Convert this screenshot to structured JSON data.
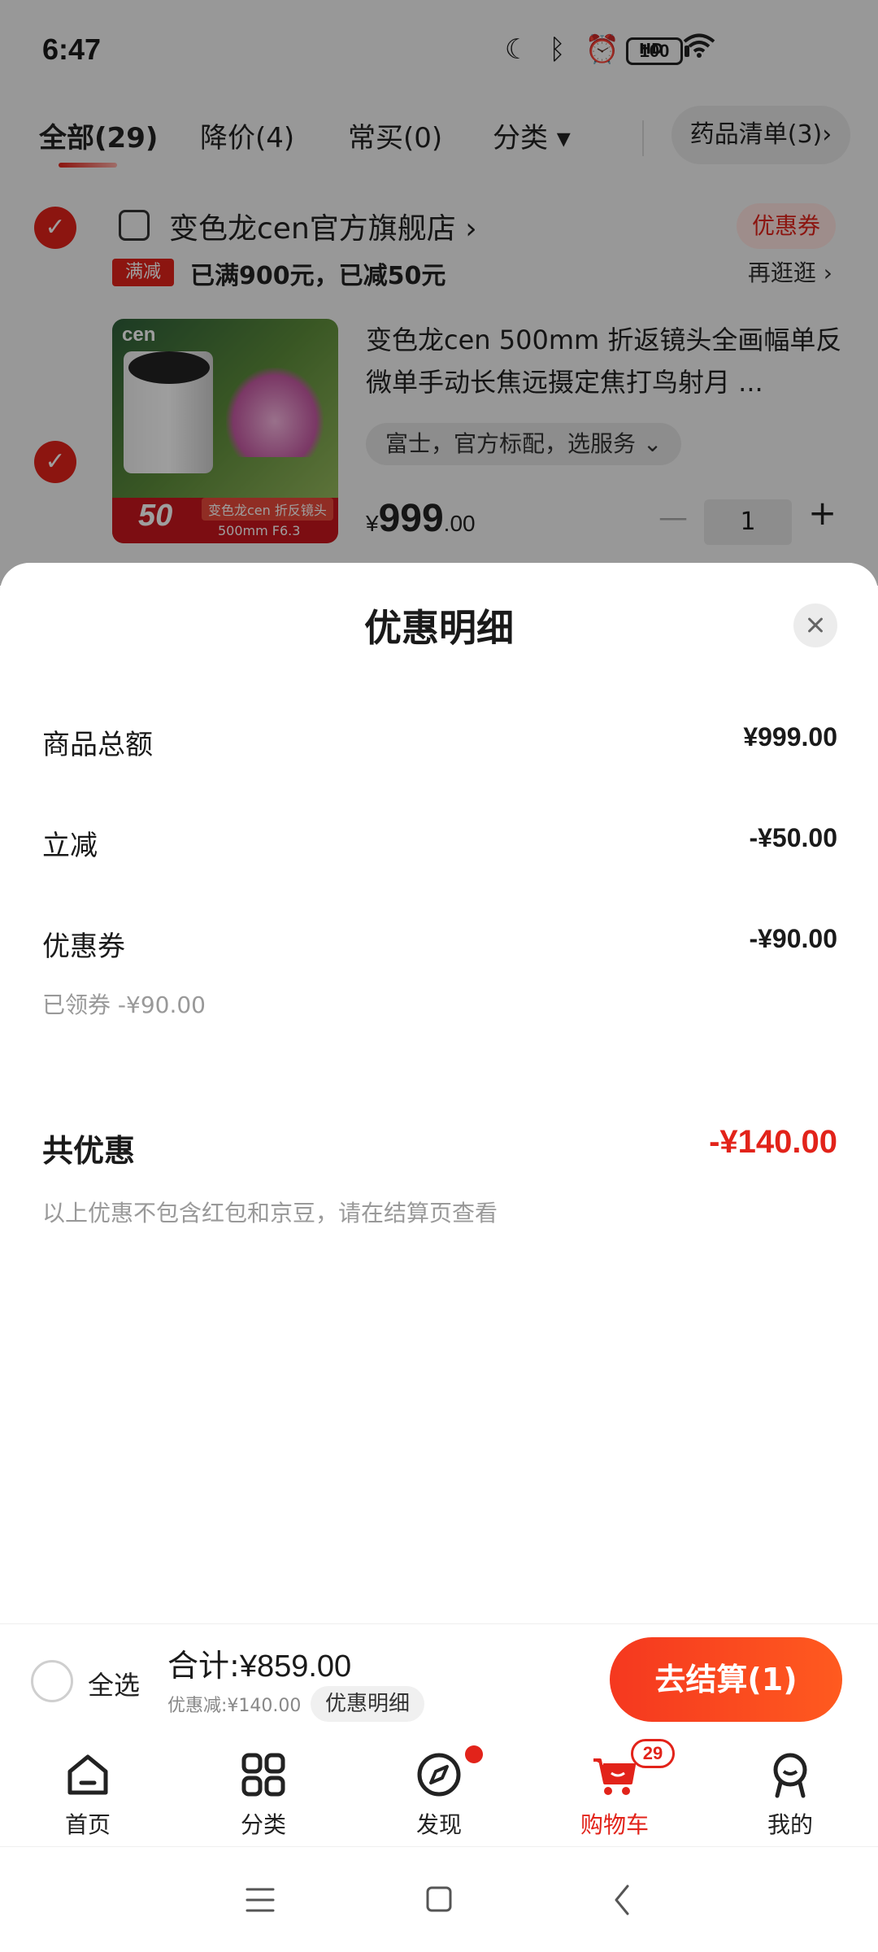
{
  "status_bar": {
    "time": "6:47",
    "battery": "100",
    "signal_label": "HD"
  },
  "tabs": [
    {
      "label": "全部(29)",
      "active": true
    },
    {
      "label": "降价(4)",
      "active": false
    },
    {
      "label": "常买(0)",
      "active": false
    },
    {
      "label": "分类 ▾",
      "active": false
    }
  ],
  "drug_list": "药品清单(3)›",
  "store": {
    "name": "变色龙cen官方旗舰店 ›",
    "coupon_tag": "优惠券",
    "promo_badge": "满减",
    "promo_text": "已满900元，已减50元",
    "promo_more": "再逛逛 ›"
  },
  "product": {
    "title": "变色龙cen 500mm 折返镜头全画幅单反微单手动长焦远摄定焦打鸟射月 ...",
    "spec": "富士，官方标配，选服务 ⌄",
    "price_symbol": "¥",
    "price_int": "999",
    "price_dec": ".00",
    "quantity": "1",
    "image_logo": "cen",
    "image_band_text": "变色龙cen 折反镜头",
    "image_band_sub": "500mm F6.3",
    "image_discount": "50"
  },
  "sheet": {
    "title": "优惠明细",
    "rows": [
      {
        "label": "商品总额",
        "value": "¥999.00"
      },
      {
        "label": "立减",
        "value": "-¥50.00"
      },
      {
        "label": "优惠券",
        "value": "-¥90.00"
      }
    ],
    "coupon_note": "已领券 -¥90.00",
    "total_label": "共优惠",
    "total_value": "-¥140.00",
    "disclaimer": "以上优惠不包含红包和京豆，请在结算页查看"
  },
  "checkout": {
    "select_all": "全选",
    "sum_label": "合计:",
    "sum_value": "¥859.00",
    "discount_text": "优惠减:¥140.00",
    "detail_chip": "优惠明细",
    "button": "去结算(1)"
  },
  "nav": [
    {
      "label": "首页",
      "icon": "home-icon"
    },
    {
      "label": "分类",
      "icon": "category-icon"
    },
    {
      "label": "发现",
      "icon": "compass-icon"
    },
    {
      "label": "购物车",
      "icon": "cart-icon",
      "badge": "29"
    },
    {
      "label": "我的",
      "icon": "profile-icon"
    }
  ],
  "colors": {
    "accent": "#e2231a",
    "checkout_gradient_end": "#ff5a1f"
  }
}
